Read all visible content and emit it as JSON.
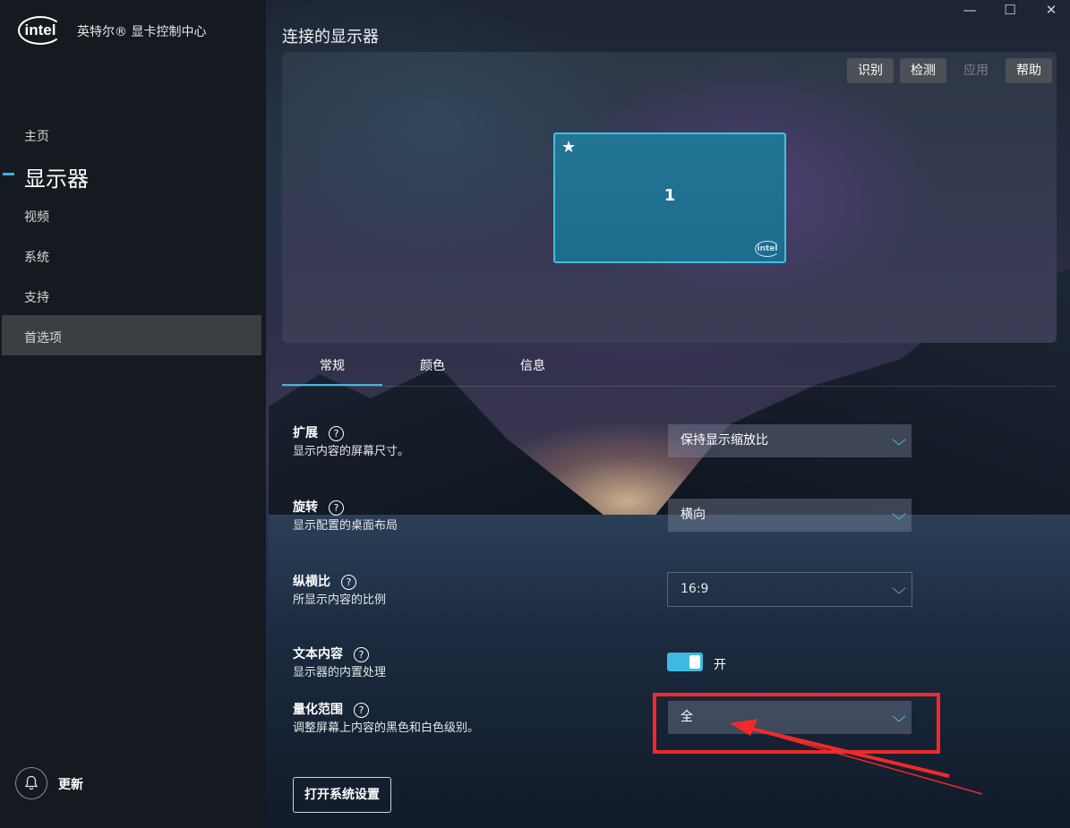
{
  "app": {
    "logo_text": "intel",
    "title": "英特尔® 显卡控制中心"
  },
  "window_controls": {
    "minimize": "—",
    "maximize": "☐",
    "close": "✕"
  },
  "sidebar": {
    "items": [
      {
        "label": "主页"
      },
      {
        "label": "显示器",
        "active": true
      },
      {
        "label": "视频"
      },
      {
        "label": "系统"
      },
      {
        "label": "支持"
      },
      {
        "label": "首选项",
        "hover": true
      }
    ],
    "update_label": "更新",
    "accent_color": "#3ab0e5"
  },
  "main": {
    "page_title": "连接的显示器",
    "panel_buttons": [
      {
        "label": "识别",
        "enabled": true
      },
      {
        "label": "检测",
        "enabled": true
      },
      {
        "label": "应用",
        "enabled": false
      },
      {
        "label": "帮助",
        "enabled": true
      }
    ],
    "monitor": {
      "star": "★",
      "number": "1",
      "logo": "intel"
    },
    "tabs": [
      {
        "label": "常规",
        "active": true
      },
      {
        "label": "颜色"
      },
      {
        "label": "信息"
      }
    ],
    "settings": {
      "scaling": {
        "title": "扩展",
        "desc": "显示内容的屏幕尺寸。",
        "value": "保持显示缩放比"
      },
      "rotation": {
        "title": "旋转",
        "desc": "显示配置的桌面布局",
        "value": "横向"
      },
      "aspect": {
        "title": "纵横比",
        "desc": "所显示内容的比例",
        "value": "16:9"
      },
      "text": {
        "title": "文本内容",
        "desc": "显示器的内置处理",
        "state": "开"
      },
      "quant": {
        "title": "量化范围",
        "desc": "调整屏幕上内容的黑色和白色级别。",
        "value": "全"
      }
    },
    "help_glyph": "?",
    "open_settings_button": "打开系统设置"
  },
  "annotation": {
    "highlight_color": "#f02a2a"
  }
}
